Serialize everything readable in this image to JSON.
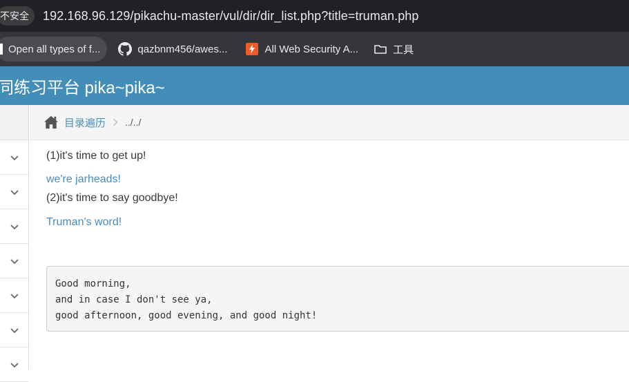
{
  "browser": {
    "security_label": "不安全",
    "url": "192.168.96.129/pikachu-master/vul/dir/dir_list.php?title=truman.php"
  },
  "bookmarks": [
    {
      "label": "Open all types of f...",
      "icon": "page-icon"
    },
    {
      "label": "qazbnm456/awes...",
      "icon": "github-icon"
    },
    {
      "label": "All Web Security A...",
      "icon": "bolt-icon"
    },
    {
      "label": "工具",
      "icon": "folder-icon"
    }
  ],
  "header": {
    "title": "同练习平台 pika~pika~"
  },
  "breadcrumb": {
    "link": "目录遍历",
    "current": "../../"
  },
  "content": {
    "line1": "(1)it's time to get up!",
    "link1": "we're jarheads!",
    "line2": "(2)it's time to say goodbye!",
    "link2": "Truman's word!",
    "pre": "Good morning,\nand in case I don't see ya,\ngood afternoon, good evening, and good night!"
  },
  "sidebar": {
    "item_count": 7
  },
  "colors": {
    "header_bg": "#438eb9",
    "link": "#4a8cc0",
    "address_bar": "#202124",
    "bookmarks_bar": "#35363a"
  }
}
